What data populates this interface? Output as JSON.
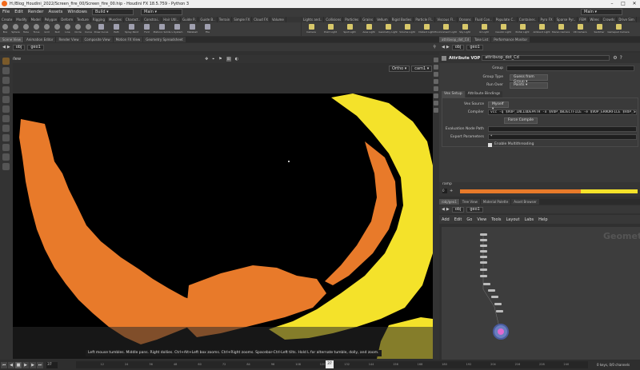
{
  "window": {
    "path": "H:/Blog_Houdini_2022/Screen_fire_00/Screen_fire_00.hip",
    "app": "Houdini FX 18.5.759 - Python 3"
  },
  "menu": [
    "File",
    "Edit",
    "Render",
    "Assets",
    "Windows",
    "Help"
  ],
  "desktop": "Build",
  "desktop2": "Main",
  "shelf_tabs_left": [
    "Create",
    "Modify",
    "Model",
    "Polygon",
    "Deform",
    "Texture",
    "Rigging",
    "Muscles",
    "Charact..",
    "Constrai..",
    "Hair Util..",
    "Guide P..",
    "Guide B..",
    "Terrain",
    "Simple FX",
    "Cloud FX",
    "Volume"
  ],
  "shelf_tabs_right": [
    "Lights and..",
    "Collisions",
    "Particles",
    "Grains",
    "Vellum",
    "Rigid Bodies",
    "Particle Fl..",
    "Viscous Fl..",
    "Oceans",
    "Fluid Con..",
    "Populate C..",
    "Container..",
    "Pyro FX",
    "Sparse Pyr..",
    "FEM",
    "Wires",
    "Crowds",
    "Drive Sim"
  ],
  "tools_left": [
    "Box",
    "Sphere",
    "Tube",
    "Torus",
    "Grid",
    "Null",
    "Line",
    "Circle",
    "Curve",
    "Draw Curve",
    "Path",
    "Spray Paint",
    "Font",
    "Platonic Solids",
    "L-System",
    "Metaball",
    "File"
  ],
  "tools_right": [
    "Camera",
    "Point Light",
    "Spot Light",
    "Area Light",
    "Geometry Light",
    "Volume Light",
    "Distant Light",
    "Environment Light",
    "Sky Light",
    "GI Light",
    "Caustic Light",
    "Portal Light",
    "Ambient Light",
    "Stereo Camera",
    "VR Camera",
    "Switcher",
    "Gamepad Camera"
  ],
  "left_panes": [
    "Scene View",
    "Animation Editor",
    "Render View",
    "Composite View",
    "Motion FX View",
    "Geometry Spreadsheet"
  ],
  "right_panes": [
    "attribvop_dot_Cd",
    "Take List",
    "Performance Monitor"
  ],
  "path": {
    "obj": "obj",
    "geo": "geo1"
  },
  "view": {
    "label": "View",
    "camera_mode": "Ortho",
    "camera": "cam1"
  },
  "viewport_hint": "Left mouse tumbles. Middle pans. Right dollies. Ctrl+Alt+Left box zooms. Ctrl+Right zooms. Spacebar-Ctrl-Left tilts. Hold L for alternate tumble, dolly, and zoom.",
  "params": {
    "node_type": "Attribute VOP",
    "node_name": "attribvop_dot_Cd",
    "group_label": "Group",
    "group_type_label": "Group Type",
    "group_type_value": "Guess from Group",
    "run_over_label": "Run Over",
    "run_over_value": "Points",
    "tabs": [
      "Vex Setup",
      "Attribute Bindings"
    ],
    "vex_source_label": "Vex Source",
    "vex_source_value": "Myself",
    "compiler_label": "Compiler",
    "compiler_value": "vcc -q $VOP_INCLUDEPATH -o $VOP_OBJECTFILE -e $VOP_ERRORFILE $VOP_SOURCEFILE",
    "force_compile": "Force Compile",
    "eval_path_label": "Evaluation Node Path",
    "export_label": "Export Parameters",
    "export_value": "*",
    "multithread_label": "Enable Multithreading"
  },
  "ramp": {
    "label": "ramp",
    "value": "0"
  },
  "net_tabs": [
    "/obj/geo1",
    "Tree View",
    "Material Palette",
    "Asset Browser"
  ],
  "net_menu": [
    "Add",
    "Edit",
    "Go",
    "View",
    "Tools",
    "Layout",
    "Labs",
    "Help"
  ],
  "net_watermark": "Geometry",
  "timeline": {
    "frame": "37",
    "start": "1",
    "end": "1",
    "keys": "0 keys, 0/0 channels",
    "ticks": [
      "12",
      "24",
      "36",
      "48",
      "60",
      "72",
      "84",
      "96",
      "108",
      "120",
      "132",
      "144",
      "156",
      "168",
      "180",
      "192",
      "204",
      "216",
      "228",
      "240"
    ]
  },
  "colors": {
    "fire_orange": "#e87a2a",
    "fire_yellow": "#f4e22a",
    "accent": "#f5a000"
  }
}
